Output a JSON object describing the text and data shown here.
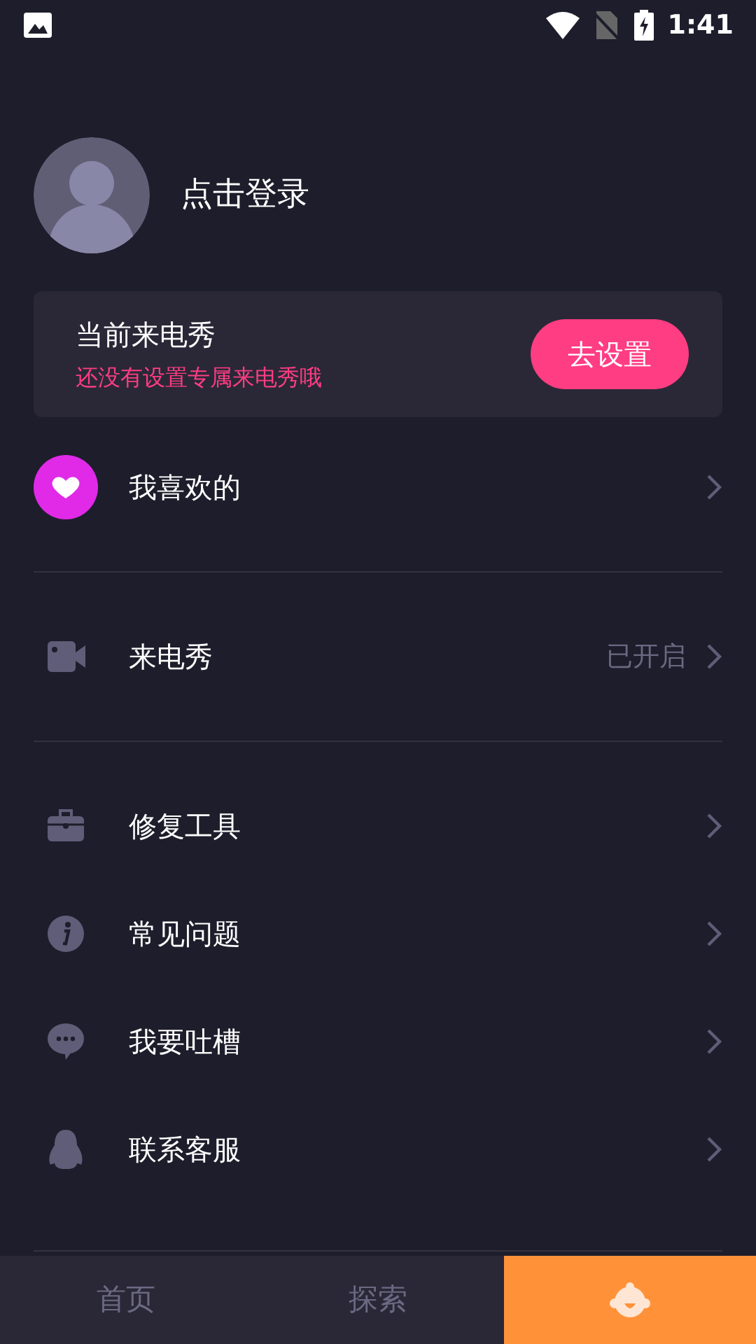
{
  "status_bar": {
    "time": "1:41"
  },
  "profile": {
    "login_label": "点击登录"
  },
  "ringtone_card": {
    "title": "当前来电秀",
    "subtitle": "还没有设置专属来电秀哦",
    "button": "去设置"
  },
  "menu_sections": [
    {
      "items": [
        {
          "kind": "favorite",
          "label": "我喜欢的"
        }
      ]
    },
    {
      "items": [
        {
          "kind": "video",
          "label": "来电秀",
          "value": "已开启"
        }
      ]
    },
    {
      "items": [
        {
          "kind": "toolbox",
          "label": "修复工具"
        },
        {
          "kind": "info",
          "label": "常见问题"
        },
        {
          "kind": "chat",
          "label": "我要吐槽"
        },
        {
          "kind": "penguin",
          "label": "联系客服"
        }
      ]
    }
  ],
  "tabs": [
    {
      "kind": "text",
      "label": "首页",
      "selected": false
    },
    {
      "kind": "text",
      "label": "探索",
      "selected": false
    },
    {
      "kind": "icon",
      "selected": true
    }
  ]
}
